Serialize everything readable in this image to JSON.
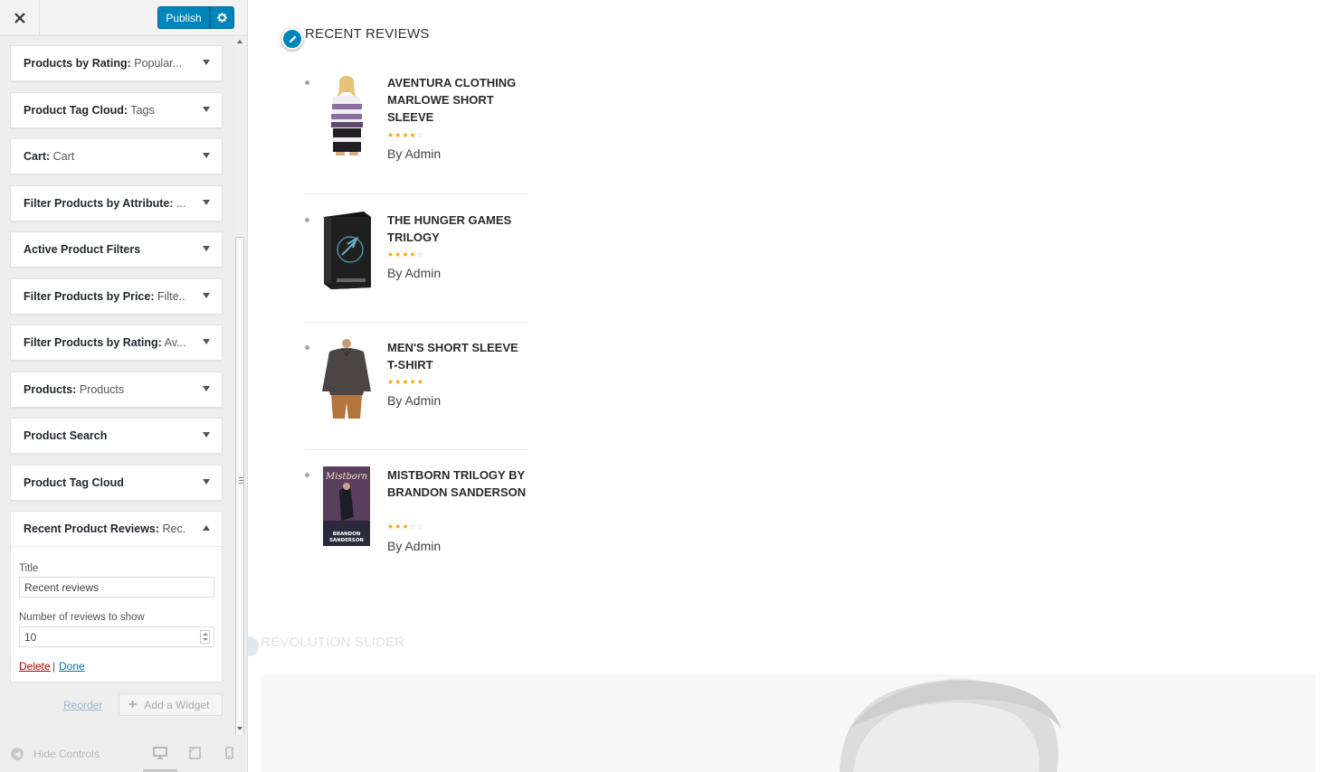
{
  "header": {
    "close_icon": "close-icon",
    "publish_label": "Publish",
    "settings_icon": "gear-icon",
    "accent": "#0085ba"
  },
  "widgets": [
    {
      "name": "Products by Rating:",
      "sub": " Popular..."
    },
    {
      "name": "Product Tag Cloud:",
      "sub": " Tags"
    },
    {
      "name": "Cart:",
      "sub": " Cart"
    },
    {
      "name": "Filter Products by Attribute:",
      "sub": " ..."
    },
    {
      "name": "Active Product Filters",
      "sub": ""
    },
    {
      "name": "Filter Products by Price:",
      "sub": " Filte..."
    },
    {
      "name": "Filter Products by Rating:",
      "sub": " Av..."
    },
    {
      "name": "Products:",
      "sub": " Products"
    },
    {
      "name": "Product Search",
      "sub": ""
    },
    {
      "name": "Product Tag Cloud",
      "sub": ""
    }
  ],
  "expanded_widget": {
    "name": "Recent Product Reviews:",
    "sub": " Rec...",
    "title_label": "Title",
    "title_value": "Recent reviews",
    "count_label": "Number of reviews to show",
    "count_value": "10",
    "delete_label": "Delete",
    "separator": "|",
    "done_label": "Done"
  },
  "sidebar_footer": {
    "reorder_label": "Reorder",
    "add_widget_label": "Add a Widget",
    "hide_controls_label": "Hide Controls",
    "devices": [
      "desktop-icon",
      "tablet-icon",
      "mobile-icon"
    ]
  },
  "preview": {
    "section_title": "RECENT REVIEWS",
    "reviews": [
      {
        "title": "AVENTURA CLOTHING MARLOWE SHORT SLEEVE",
        "rating": 4,
        "max": 5,
        "author": "By Admin",
        "image": "striped-shirt-woman"
      },
      {
        "title": "THE HUNGER GAMES TRILOGY",
        "rating": 4,
        "max": 5,
        "author": "By Admin",
        "image": "book-box-set"
      },
      {
        "title": "MEN'S SHORT SLEEVE T-SHIRT",
        "rating": 5,
        "max": 5,
        "author": "By Admin",
        "image": "man-shirt"
      },
      {
        "title": "MISTBORN TRILOGY BY BRANDON SANDERSON",
        "rating": 3,
        "max": 5,
        "author": "By Admin",
        "image": "mistborn-book-cover"
      }
    ],
    "book_cover_text": "Mistborn",
    "book_author_text": "BRANDON SANDERSON",
    "next_section_title": "REVOLUTION SLIDER"
  }
}
